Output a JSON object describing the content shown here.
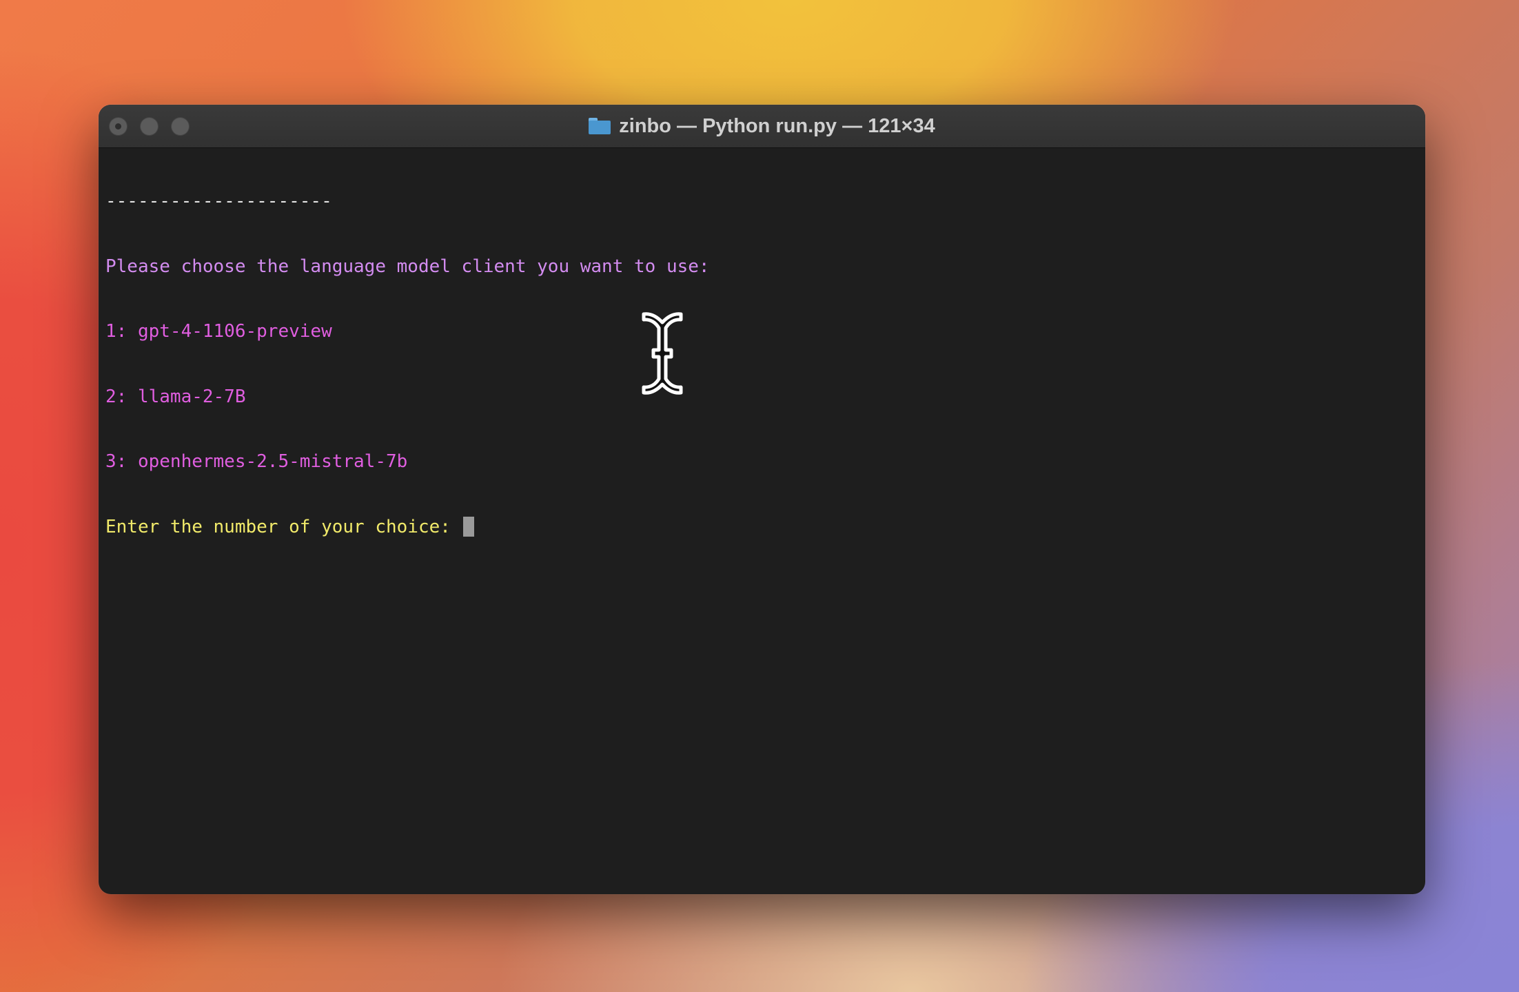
{
  "window": {
    "title": "zinbo — Python run.py — 121×34",
    "title_icon": "folder-icon",
    "traffic_lights": [
      "close",
      "minimize",
      "zoom"
    ]
  },
  "terminal": {
    "lines": [
      {
        "text": "---------------------",
        "color": "#e6e6e6"
      },
      {
        "text": "Please choose the language model client you want to use:",
        "color": "#d38cf0"
      },
      {
        "text": "1: gpt-4-1106-preview",
        "color": "#e05ee0"
      },
      {
        "text": "2: llama-2-7B",
        "color": "#e05ee0"
      },
      {
        "text": "3: openhermes-2.5-mistral-7b",
        "color": "#e05ee0"
      }
    ],
    "prompt": "Enter the number of your choice: ",
    "prompt_color": "#f1ea6a",
    "input_value": ""
  },
  "pointer": {
    "icon": "ibeam-cursor-icon"
  }
}
